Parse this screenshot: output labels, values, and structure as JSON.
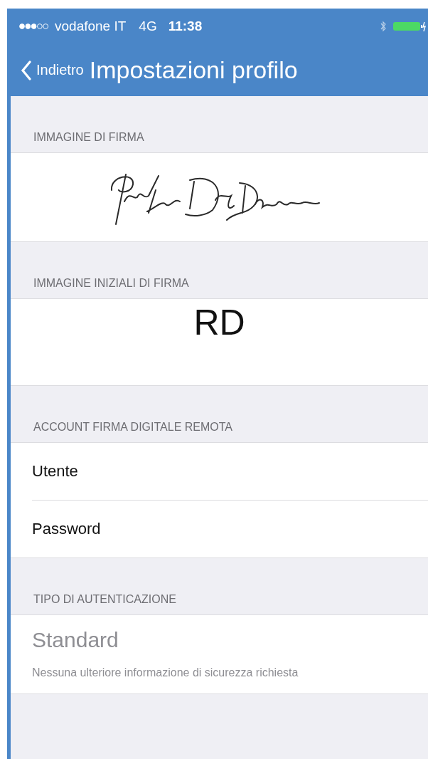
{
  "status_bar": {
    "carrier": "vodafone IT",
    "network": "4G",
    "time": "11:38"
  },
  "nav_bar": {
    "back": "Indietro",
    "title": "Impostazioni profilo"
  },
  "sections": [
    {
      "header": "IMMAGINE DI FIRMA",
      "kind": "signature"
    },
    {
      "header": "IMMAGINE INIZIALI DI FIRMA",
      "kind": "initials",
      "initials": "RD"
    },
    {
      "header": "ACCOUNT FIRMA DIGITALE REMOTA",
      "kind": "fields",
      "fields": [
        "Utente",
        "Password"
      ]
    },
    {
      "header": "TIPO DI AUTENTICAZIONE",
      "kind": "option",
      "title": "Standard",
      "description": "Nessuna ulteriore informazione di sicurezza richiesta"
    }
  ]
}
